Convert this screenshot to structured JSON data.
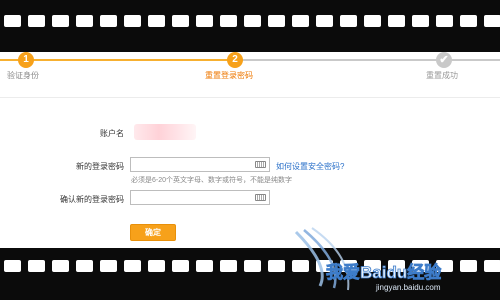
{
  "steps": [
    {
      "num": "1",
      "label": "验证身份",
      "state": "done"
    },
    {
      "num": "2",
      "label": "重置登录密码",
      "state": "active"
    },
    {
      "num": "✔",
      "label": "重置成功",
      "state": "pending"
    }
  ],
  "colors": {
    "accent": "#f7a11a",
    "active_text": "#ee7700",
    "link": "#2a70c9",
    "inactive": "#c9c9c9"
  },
  "form": {
    "account_label": "账户名",
    "new_password_label": "新的登录密码",
    "confirm_password_label": "确认新的登录密码",
    "help_link": "如何设置安全密码?",
    "hint": "必须是6-20个英文字母、数字或符号，不能是纯数字",
    "submit_label": "确定",
    "keyboard_icon": "keyboard-icon"
  },
  "watermark": {
    "text": "我爱Baidu经验",
    "subtext": "jingyan.baidu.com"
  }
}
